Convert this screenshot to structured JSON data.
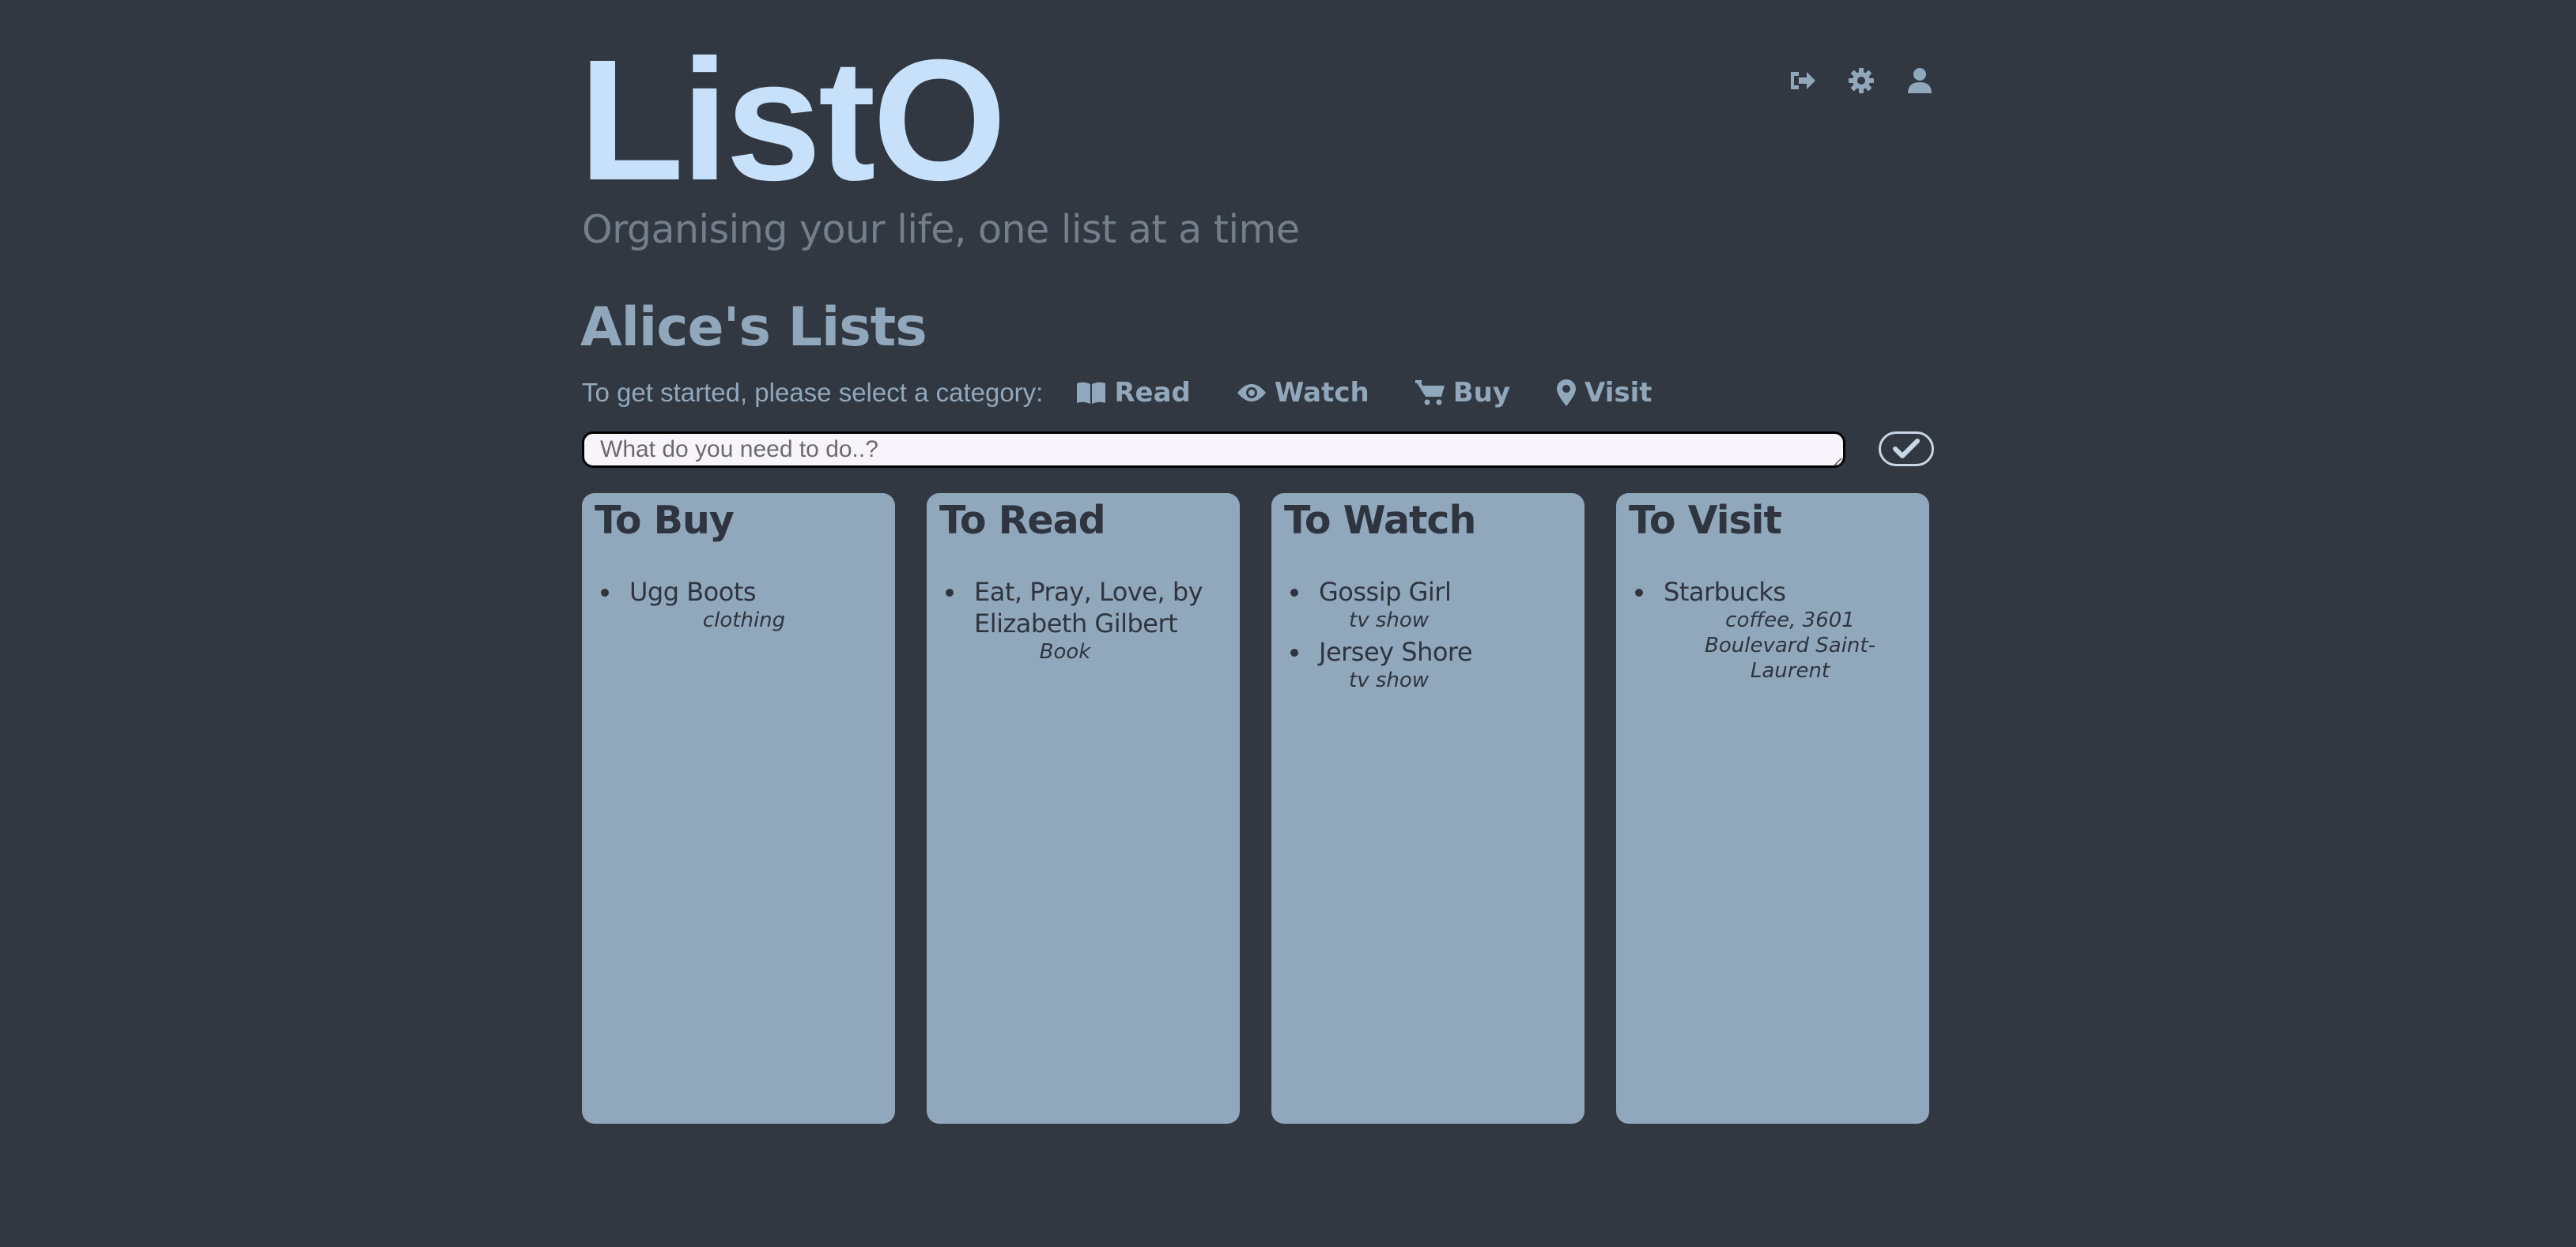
{
  "app": {
    "logo": "ListO",
    "tagline": "Organising your life, one list at a time"
  },
  "header": {
    "icons": [
      {
        "name": "logout-icon"
      },
      {
        "name": "gear-icon"
      },
      {
        "name": "user-icon"
      }
    ]
  },
  "main": {
    "title": "Alice's Lists",
    "prompt": "To get started, please select a category:",
    "categories": [
      {
        "label": "Read",
        "icon": "book-icon"
      },
      {
        "label": "Watch",
        "icon": "eye-icon"
      },
      {
        "label": "Buy",
        "icon": "cart-icon"
      },
      {
        "label": "Visit",
        "icon": "map-marker-icon"
      }
    ],
    "input": {
      "placeholder": "What do you need to do..?",
      "value": ""
    },
    "submit_icon": "check-icon"
  },
  "lists": [
    {
      "title": "To Buy",
      "items": [
        {
          "name": "Ugg Boots",
          "category": "clothing"
        }
      ]
    },
    {
      "title": "To Read",
      "items": [
        {
          "name": "Eat, Pray, Love, by Elizabeth Gilbert",
          "category": "Book"
        }
      ]
    },
    {
      "title": "To Watch",
      "items": [
        {
          "name": "Gossip Girl",
          "category": "tv show"
        },
        {
          "name": "Jersey Shore",
          "category": "tv show"
        }
      ]
    },
    {
      "title": "To Visit",
      "items": [
        {
          "name": "Starbucks",
          "category": "coffee, 3601 Boulevard Saint-Laurent"
        }
      ]
    }
  ],
  "colors": {
    "background": "#323842",
    "logo": "#c8e1fb",
    "accent": "#91a7bb",
    "card": "#91a7bb",
    "card_text": "#2f3540"
  }
}
